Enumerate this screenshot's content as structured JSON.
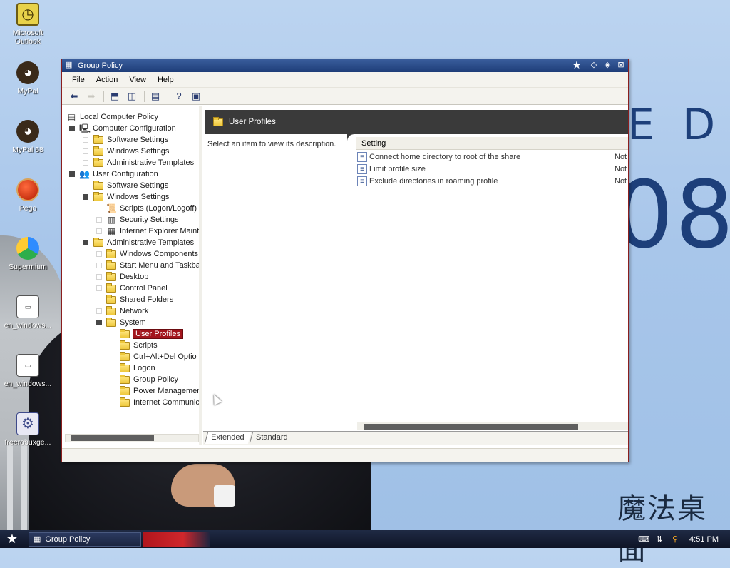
{
  "desktop": {
    "background_text_ed": "E D",
    "background_text_08": "08",
    "logo_text": "魔法桌面",
    "icons": [
      {
        "label": "Microsoft Outlook",
        "icon": "outlook-icon"
      },
      {
        "label": "MyPal",
        "icon": "mypal-icon"
      },
      {
        "label": "MyPal 68",
        "icon": "mypal68-icon"
      },
      {
        "label": "Pego",
        "icon": "pego-icon"
      },
      {
        "label": "Supermium",
        "icon": "supermium-icon"
      },
      {
        "label": "en_windows...",
        "icon": "iso-file-icon"
      },
      {
        "label": "en_windows...",
        "icon": "iso-file-icon"
      },
      {
        "label": "freerobuxge...",
        "icon": "application-icon"
      }
    ]
  },
  "window": {
    "title": "Group Policy",
    "menu": [
      "File",
      "Action",
      "View",
      "Help"
    ],
    "toolbar": [
      "back-icon",
      "forward-icon",
      "up-folder-icon",
      "show-hide-tree-icon",
      "export-list-icon",
      "help-icon",
      "properties-icon"
    ],
    "tree": [
      {
        "label": "Local Computer Policy",
        "level": 0,
        "icon": "computer-policy-icon"
      },
      {
        "label": "Computer Configuration",
        "level": 1,
        "icon": "computer-icon"
      },
      {
        "label": "Software Settings",
        "level": 2,
        "icon": "folder"
      },
      {
        "label": "Windows Settings",
        "level": 2,
        "icon": "folder"
      },
      {
        "label": "Administrative Templates",
        "level": 2,
        "icon": "folder"
      },
      {
        "label": "User Configuration",
        "level": 1,
        "icon": "user-icon"
      },
      {
        "label": "Software Settings",
        "level": 2,
        "icon": "folder"
      },
      {
        "label": "Windows Settings",
        "level": 2,
        "icon": "folder"
      },
      {
        "label": "Scripts (Logon/Logoff)",
        "level": 3,
        "icon": "script-icon"
      },
      {
        "label": "Security Settings",
        "level": 3,
        "icon": "security-icon"
      },
      {
        "label": "Internet Explorer Maint",
        "level": 3,
        "icon": "ie-icon"
      },
      {
        "label": "Administrative Templates",
        "level": 2,
        "icon": "folder"
      },
      {
        "label": "Windows Components",
        "level": 3,
        "icon": "folder"
      },
      {
        "label": "Start Menu and Taskba",
        "level": 3,
        "icon": "folder"
      },
      {
        "label": "Desktop",
        "level": 3,
        "icon": "folder"
      },
      {
        "label": "Control Panel",
        "level": 3,
        "icon": "folder"
      },
      {
        "label": "Shared Folders",
        "level": 3,
        "icon": "folder"
      },
      {
        "label": "Network",
        "level": 3,
        "icon": "folder"
      },
      {
        "label": "System",
        "level": 3,
        "icon": "folder"
      },
      {
        "label": "User Profiles",
        "level": 4,
        "icon": "folder",
        "selected": true
      },
      {
        "label": "Scripts",
        "level": 4,
        "icon": "folder"
      },
      {
        "label": "Ctrl+Alt+Del Optio",
        "level": 4,
        "icon": "folder"
      },
      {
        "label": "Logon",
        "level": 4,
        "icon": "folder"
      },
      {
        "label": "Group Policy",
        "level": 4,
        "icon": "folder"
      },
      {
        "label": "Power Managemen",
        "level": 4,
        "icon": "folder"
      },
      {
        "label": "Internet Communic",
        "level": 4,
        "icon": "folder"
      }
    ],
    "details": {
      "header_title": "User Profiles",
      "description": "Select an item to view its description.",
      "column_setting": "Setting",
      "rows": [
        {
          "setting": "Connect home directory to root of the share",
          "state": "Not"
        },
        {
          "setting": "Limit profile size",
          "state": "Not"
        },
        {
          "setting": "Exclude directories in roaming profile",
          "state": "Not"
        }
      ]
    },
    "tabs": [
      {
        "label": "Extended",
        "active": true
      },
      {
        "label": "Standard",
        "active": false
      }
    ]
  },
  "taskbar": {
    "task_label": "Group Policy",
    "clock": "4:51 PM"
  },
  "colors": {
    "selection": "#a3151d",
    "titlebar": "#1e3d78",
    "details_header": "#3a3a3a"
  }
}
